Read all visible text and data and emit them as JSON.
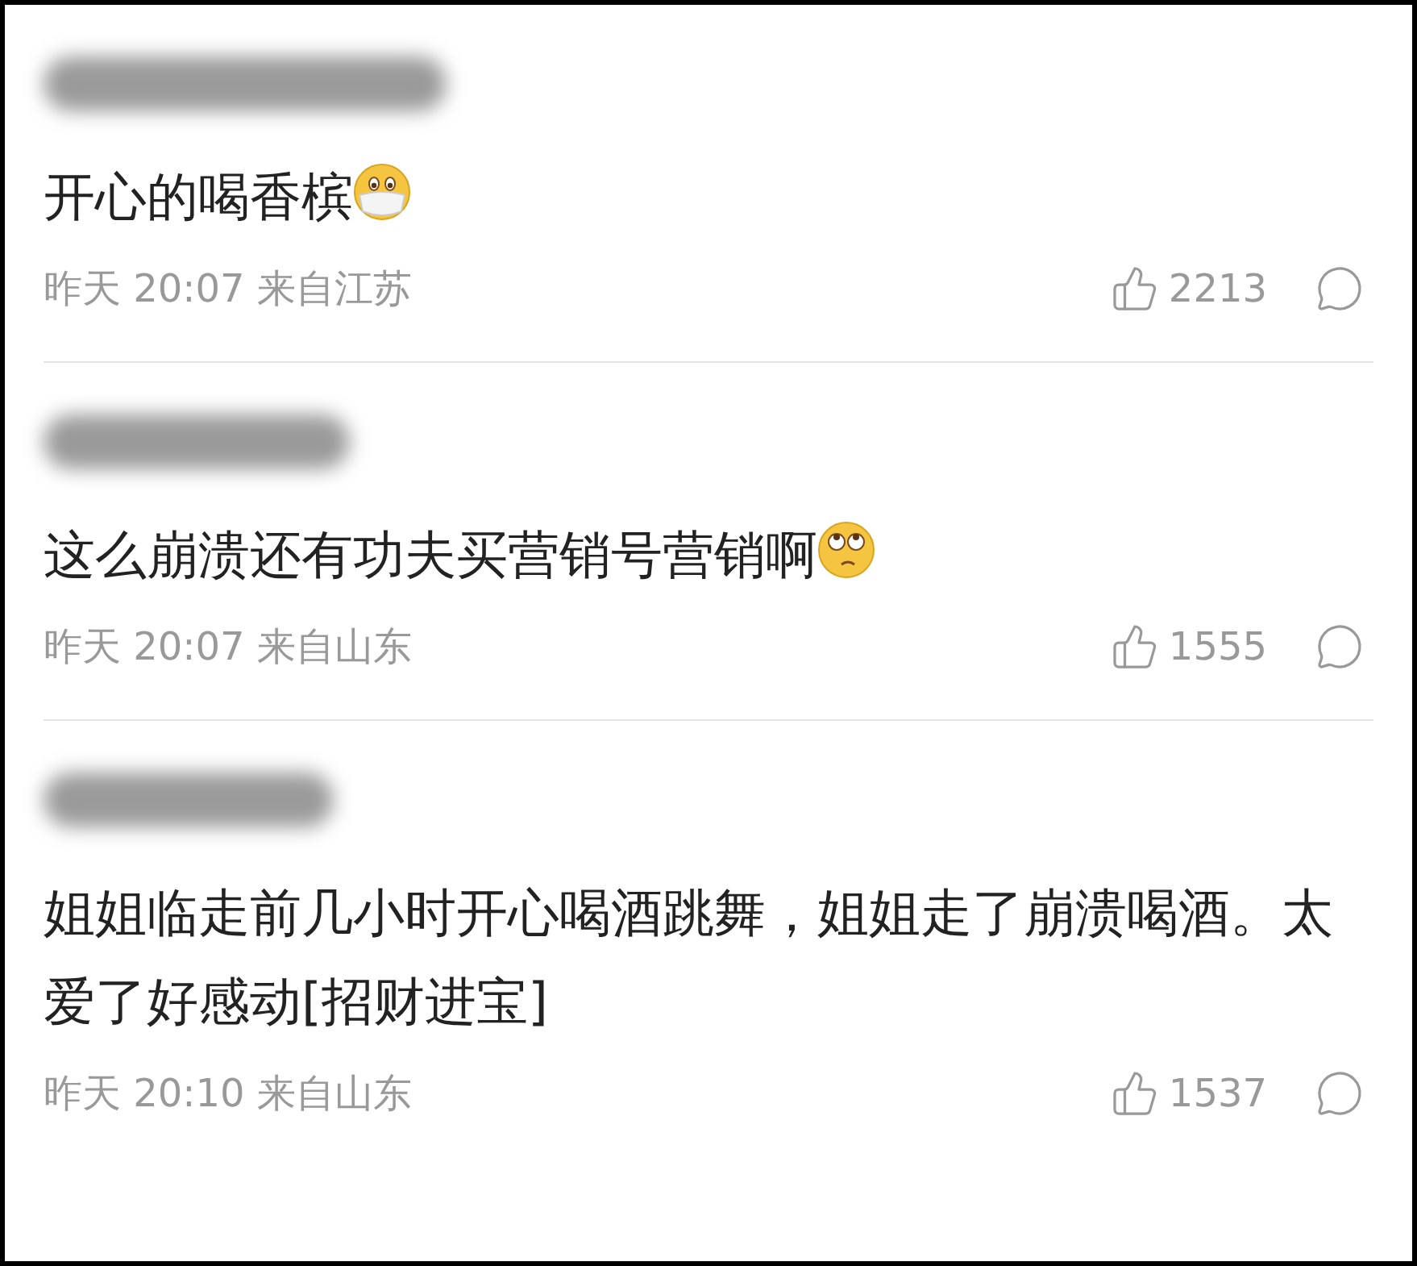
{
  "comments": [
    {
      "text": "开心的喝香槟",
      "emoji": {
        "kind": "mask"
      },
      "meta": "昨天 20:07 来自江苏",
      "likes": "2213"
    },
    {
      "text": "这么崩溃还有功夫买营销号营销啊",
      "emoji": {
        "kind": "eyeroll"
      },
      "meta": "昨天 20:07 来自山东",
      "likes": "1555"
    },
    {
      "text": "姐姐临走前几小时开心喝酒跳舞，姐姐走了崩溃喝酒。太爱了好感动[招财进宝]",
      "meta": "昨天 20:10 来自山东",
      "likes": "1537"
    }
  ]
}
